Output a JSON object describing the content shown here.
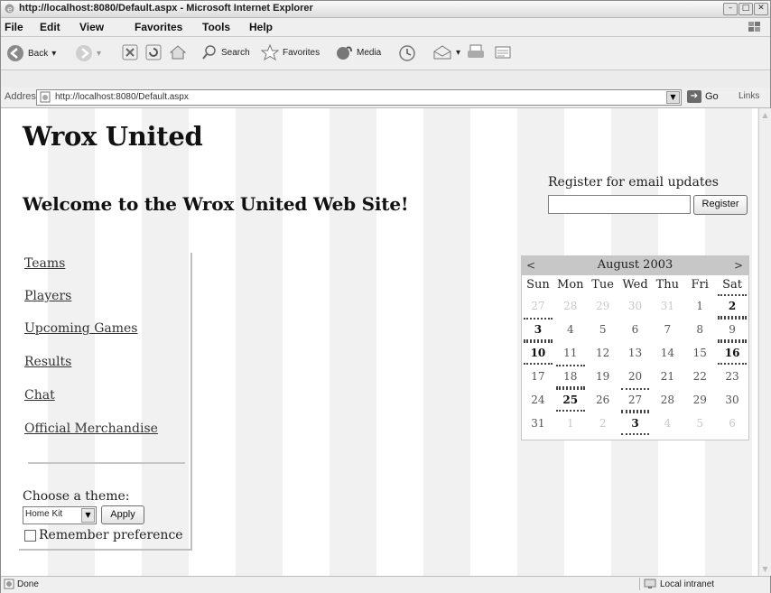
{
  "window": {
    "title": "http://localhost:8080/Default.aspx - Microsoft Internet Explorer",
    "controls": [
      "minimize-icon",
      "maximize-icon",
      "close-icon"
    ]
  },
  "menubar": {
    "items": [
      {
        "label": "File",
        "name": "menu-file"
      },
      {
        "label": "Edit",
        "name": "menu-edit"
      },
      {
        "label": "View",
        "name": "menu-view"
      },
      {
        "label": "Favorites",
        "name": "menu-favorites"
      },
      {
        "label": "Tools",
        "name": "menu-tools"
      },
      {
        "label": "Help",
        "name": "menu-help"
      }
    ]
  },
  "toolbar": {
    "back": "Back",
    "search": "Search",
    "favorites": "Favorites",
    "media": "Media"
  },
  "address": {
    "label": "Address",
    "url": "http://localhost:8080/Default.aspx",
    "go": "Go",
    "links": "Links"
  },
  "page": {
    "site_title": "Wrox United",
    "welcome": "Welcome to the Wrox United Web Site!",
    "nav": [
      "Teams",
      "Players",
      "Upcoming Games",
      "Results",
      "Chat",
      "Official Merchandise"
    ],
    "theme": {
      "label": "Choose a theme:",
      "selected": "Home Kit",
      "apply": "Apply",
      "remember": "Remember preference"
    },
    "register": {
      "label": "Register for email updates",
      "input_value": "",
      "button": "Register"
    },
    "calendar": {
      "prev": "<",
      "next": ">",
      "month": "August 2003",
      "weekdays": [
        "Sun",
        "Mon",
        "Tue",
        "Wed",
        "Thu",
        "Fri",
        "Sat"
      ],
      "weeks": [
        [
          {
            "d": "27",
            "o": true
          },
          {
            "d": "28",
            "o": true
          },
          {
            "d": "29",
            "o": true
          },
          {
            "d": "30",
            "o": true
          },
          {
            "d": "31",
            "o": true
          },
          {
            "d": "1"
          },
          {
            "d": "2",
            "e": true
          }
        ],
        [
          {
            "d": "3",
            "e": true
          },
          {
            "d": "4"
          },
          {
            "d": "5"
          },
          {
            "d": "6"
          },
          {
            "d": "7"
          },
          {
            "d": "8"
          },
          {
            "d": "9",
            "s": true
          }
        ],
        [
          {
            "d": "10",
            "e": true
          },
          {
            "d": "11"
          },
          {
            "d": "12"
          },
          {
            "d": "13"
          },
          {
            "d": "14"
          },
          {
            "d": "15"
          },
          {
            "d": "16",
            "e": true
          }
        ],
        [
          {
            "d": "17"
          },
          {
            "d": "18",
            "s": true
          },
          {
            "d": "19"
          },
          {
            "d": "20"
          },
          {
            "d": "21"
          },
          {
            "d": "22"
          },
          {
            "d": "23"
          }
        ],
        [
          {
            "d": "24"
          },
          {
            "d": "25",
            "e": true
          },
          {
            "d": "26"
          },
          {
            "d": "27",
            "s": true
          },
          {
            "d": "28"
          },
          {
            "d": "29"
          },
          {
            "d": "30"
          }
        ],
        [
          {
            "d": "31"
          },
          {
            "d": "1",
            "o": true
          },
          {
            "d": "2",
            "o": true
          },
          {
            "d": "3",
            "e": true
          },
          {
            "d": "4",
            "o": true
          },
          {
            "d": "5",
            "o": true
          },
          {
            "d": "6",
            "o": true
          }
        ]
      ]
    }
  },
  "status": {
    "text": "Done",
    "zone": "Local intranet"
  }
}
